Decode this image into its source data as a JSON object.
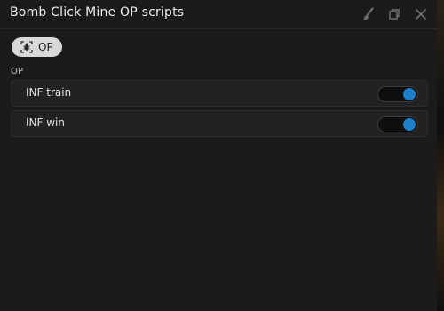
{
  "window": {
    "title": "Bomb Click Mine OP scripts",
    "accent_color": "#1e7fc9",
    "title_icons": [
      "paintbrush-icon",
      "restore-icon",
      "close-icon"
    ]
  },
  "tabs": [
    {
      "label": "OP",
      "icon": "bug-icon",
      "selected": true
    }
  ],
  "section": {
    "label": "OP",
    "toggles": [
      {
        "label": "INF train",
        "on": true
      },
      {
        "label": "INF win",
        "on": true
      }
    ]
  }
}
